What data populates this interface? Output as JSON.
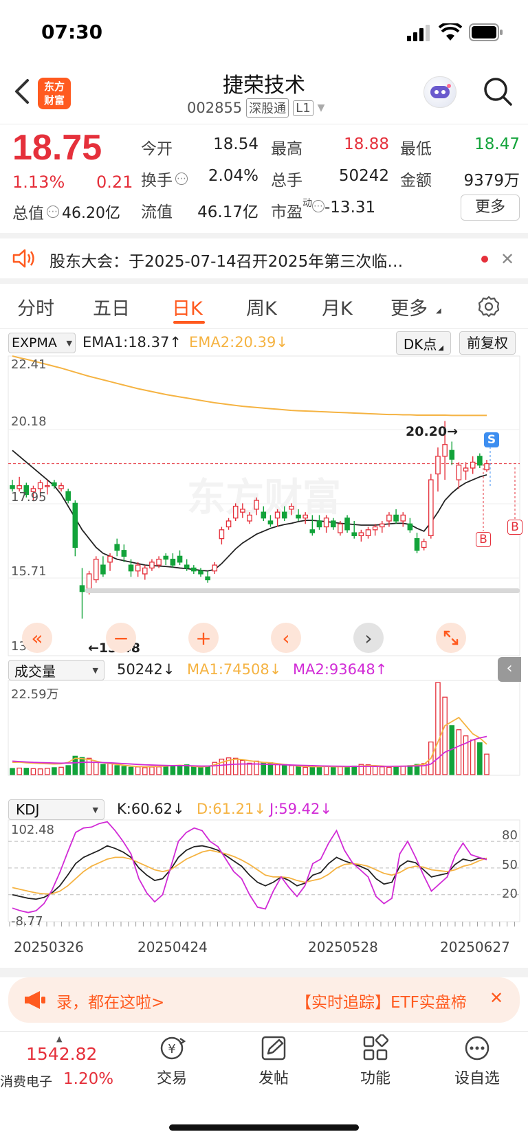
{
  "status_bar": {
    "time": "07:30"
  },
  "header": {
    "logo_line1": "东方",
    "logo_line2": "财富",
    "title": "捷荣技术",
    "code": "002855",
    "market_tag": "深股通",
    "level_tag": "L1"
  },
  "quote": {
    "price": "18.75",
    "change_pct": "1.13%",
    "change": "0.21",
    "fields": {
      "open_label": "今开",
      "open": "18.54",
      "high_label": "最高",
      "high": "18.88",
      "low_label": "最低",
      "low": "18.47",
      "turnover_label": "换手",
      "turnover": "2.04%",
      "volume_label": "总手",
      "volume": "50242",
      "amount_label": "金额",
      "amount": "9379万",
      "mktcap_label": "总值",
      "mktcap": "46.20亿",
      "float_label": "流值",
      "float": "46.17亿",
      "pe_label": "市盈",
      "pe_sup": "动",
      "pe": "-13.31"
    },
    "more_button": "更多"
  },
  "notice": {
    "text": "股东大会：于2025-07-14召开2025年第三次临…"
  },
  "tabs": {
    "items": [
      "分时",
      "五日",
      "日K",
      "周K",
      "月K",
      "更多"
    ],
    "active_index": 2
  },
  "kline": {
    "indicator_select": "EXPMA",
    "ema1": "EMA1:18.37",
    "ema2": "EMA2:20.39",
    "dk_button": "DK点",
    "adjust_button": "前复权",
    "y_labels": [
      "22.41",
      "20.18",
      "17.95",
      "15.71",
      "13.48"
    ],
    "high_marker": "20.20",
    "low_marker": "13.48",
    "signal_s": "S",
    "signal_b": "B",
    "watermark": "东方财富"
  },
  "volume_panel": {
    "indicator_select": "成交量",
    "value": "50242",
    "ma1": "MA1:74508",
    "ma2": "MA2:93648",
    "max_label": "22.59万"
  },
  "kdj_panel": {
    "indicator_select": "KDJ",
    "k": "K:60.62",
    "d": "D:61.21",
    "j": "J:59.42",
    "max_label": "102.48",
    "min_label": "-8.77",
    "levels": [
      "80",
      "50",
      "20"
    ]
  },
  "x_dates": [
    "20250326",
    "20250424",
    "20250528",
    "20250627"
  ],
  "ticker": {
    "left": "录，都在这啦>",
    "right": "【实时追踪】ETF实盘楴"
  },
  "bottom_nav": {
    "index_value": "1542.82",
    "index_name": "消费电子",
    "index_change": "1.20%",
    "items": [
      "交易",
      "发帖",
      "功能",
      "设自选"
    ]
  },
  "colors": {
    "up": "#e5303b",
    "down": "#12a33a",
    "ema2": "#f5b342",
    "ma2": "#d12bd6",
    "brand": "#ff5a1f"
  },
  "chart_data": [
    {
      "type": "candlestick",
      "title": "",
      "ylim": [
        13.48,
        22.41
      ],
      "x_labels": [
        "20250326",
        "20250424",
        "20250528",
        "20250627"
      ],
      "candles": [
        [
          18.0,
          18.2,
          17.8,
          17.9
        ],
        [
          17.9,
          18.3,
          17.8,
          18.0
        ],
        [
          18.0,
          18.1,
          17.6,
          17.7
        ],
        [
          17.8,
          18.0,
          17.5,
          17.9
        ],
        [
          17.9,
          18.2,
          17.6,
          18.1
        ],
        [
          18.0,
          18.2,
          17.7,
          18.0
        ],
        [
          18.1,
          18.2,
          17.9,
          18.0
        ],
        [
          17.9,
          18.1,
          17.8,
          18.0
        ],
        [
          17.8,
          17.9,
          17.4,
          17.5
        ],
        [
          17.4,
          17.5,
          15.6,
          15.9
        ],
        [
          14.6,
          15.2,
          13.48,
          14.4
        ],
        [
          14.5,
          15.1,
          14.3,
          15.0
        ],
        [
          14.8,
          15.6,
          14.7,
          15.5
        ],
        [
          15.3,
          15.6,
          14.9,
          15.0
        ],
        [
          15.4,
          15.7,
          15.1,
          15.6
        ],
        [
          16.0,
          16.2,
          15.6,
          15.8
        ],
        [
          15.8,
          16.0,
          15.4,
          15.6
        ],
        [
          15.3,
          15.5,
          14.9,
          15.1
        ],
        [
          15.1,
          15.4,
          14.9,
          15.3
        ],
        [
          15.0,
          15.3,
          14.8,
          15.2
        ],
        [
          15.2,
          15.5,
          15.1,
          15.4
        ],
        [
          15.3,
          15.6,
          15.2,
          15.5
        ],
        [
          15.6,
          15.7,
          15.3,
          15.5
        ],
        [
          15.5,
          15.7,
          15.2,
          15.3
        ],
        [
          15.6,
          15.8,
          15.3,
          15.4
        ],
        [
          15.3,
          15.5,
          15.1,
          15.2
        ],
        [
          15.2,
          15.3,
          15.0,
          15.1
        ],
        [
          15.1,
          15.2,
          14.9,
          15.0
        ],
        [
          14.9,
          15.1,
          14.7,
          14.8
        ],
        [
          15.1,
          15.4,
          15.0,
          15.3
        ],
        [
          16.2,
          16.6,
          16.0,
          16.5
        ],
        [
          16.6,
          16.9,
          16.5,
          16.8
        ],
        [
          16.9,
          17.4,
          16.8,
          17.3
        ],
        [
          17.1,
          17.4,
          16.9,
          17.2
        ],
        [
          16.8,
          17.1,
          16.7,
          17.0
        ],
        [
          17.2,
          17.6,
          17.0,
          17.5
        ],
        [
          17.1,
          17.3,
          16.8,
          16.9
        ],
        [
          16.8,
          17.0,
          16.6,
          16.7
        ],
        [
          16.9,
          17.2,
          16.6,
          17.1
        ],
        [
          17.1,
          17.3,
          16.8,
          16.9
        ],
        [
          17.2,
          17.4,
          17.0,
          17.3
        ],
        [
          17.0,
          17.2,
          16.8,
          16.9
        ],
        [
          16.9,
          17.1,
          16.7,
          17.0
        ],
        [
          16.5,
          17.0,
          16.3,
          16.4
        ],
        [
          16.8,
          17.0,
          16.5,
          16.6
        ],
        [
          16.6,
          17.0,
          16.4,
          16.9
        ],
        [
          16.8,
          16.9,
          16.5,
          16.6
        ],
        [
          16.4,
          16.8,
          16.3,
          16.7
        ],
        [
          16.9,
          17.0,
          16.4,
          16.5
        ],
        [
          16.4,
          16.8,
          16.2,
          16.3
        ],
        [
          16.3,
          16.5,
          16.1,
          16.4
        ],
        [
          16.3,
          16.6,
          16.2,
          16.5
        ],
        [
          16.5,
          16.7,
          16.3,
          16.6
        ],
        [
          16.6,
          16.8,
          16.4,
          16.7
        ],
        [
          16.8,
          17.1,
          16.6,
          17.0
        ],
        [
          17.0,
          17.2,
          16.7,
          16.8
        ],
        [
          16.8,
          17.1,
          16.6,
          17.0
        ],
        [
          16.7,
          16.9,
          16.4,
          16.5
        ],
        [
          16.2,
          16.4,
          15.7,
          15.8
        ],
        [
          15.9,
          16.2,
          15.8,
          16.1
        ],
        [
          16.3,
          18.4,
          16.2,
          18.2
        ],
        [
          18.4,
          19.3,
          17.8,
          19.0
        ],
        [
          19.0,
          20.2,
          18.2,
          19.4
        ],
        [
          19.2,
          19.5,
          18.7,
          18.9
        ],
        [
          18.2,
          18.8,
          17.9,
          18.7
        ],
        [
          18.5,
          18.8,
          18.2,
          18.6
        ],
        [
          18.6,
          19.0,
          18.4,
          18.8
        ],
        [
          19.0,
          19.1,
          18.6,
          18.7
        ],
        [
          18.54,
          18.88,
          18.47,
          18.75
        ]
      ],
      "ema1": [
        19.2,
        19.0,
        18.8,
        18.6,
        18.4,
        18.2,
        18.0,
        17.7,
        17.3,
        16.9,
        16.5,
        16.2,
        15.9,
        15.7,
        15.6,
        15.5,
        15.45,
        15.4,
        15.35,
        15.3,
        15.28,
        15.27,
        15.25,
        15.23,
        15.2,
        15.18,
        15.15,
        15.12,
        15.1,
        15.15,
        15.35,
        15.6,
        15.85,
        16.05,
        16.2,
        16.35,
        16.45,
        16.55,
        16.62,
        16.68,
        16.72,
        16.78,
        16.82,
        16.82,
        16.8,
        16.78,
        16.75,
        16.72,
        16.7,
        16.68,
        16.66,
        16.66,
        16.66,
        16.68,
        16.7,
        16.72,
        16.72,
        16.68,
        16.55,
        16.45,
        16.75,
        17.1,
        17.5,
        17.75,
        17.95,
        18.1,
        18.2,
        18.3,
        18.37
      ],
      "ema2": [
        22.41,
        22.35,
        22.3,
        22.24,
        22.18,
        22.12,
        22.06,
        22.0,
        21.93,
        21.86,
        21.79,
        21.72,
        21.66,
        21.6,
        21.54,
        21.48,
        21.42,
        21.36,
        21.3,
        21.25,
        21.2,
        21.15,
        21.1,
        21.06,
        21.02,
        20.98,
        20.94,
        20.9,
        20.86,
        20.82,
        20.79,
        20.76,
        20.73,
        20.7,
        20.68,
        20.66,
        20.64,
        20.62,
        20.6,
        20.58,
        20.56,
        20.55,
        20.54,
        20.53,
        20.52,
        20.51,
        20.5,
        20.49,
        20.48,
        20.47,
        20.46,
        20.45,
        20.44,
        20.43,
        20.42,
        20.42,
        20.41,
        20.41,
        20.4,
        20.4,
        20.4,
        20.4,
        20.4,
        20.39,
        20.39,
        20.39,
        20.39,
        20.39,
        20.39
      ]
    },
    {
      "type": "bar",
      "title": "",
      "ylim": [
        0,
        225900
      ],
      "values": [
        15000,
        16000,
        15500,
        14500,
        14000,
        15500,
        17000,
        18000,
        22000,
        45000,
        42000,
        40000,
        30000,
        25000,
        27000,
        22000,
        20000,
        18000,
        19000,
        17000,
        18500,
        19000,
        21000,
        20000,
        22000,
        24000,
        19000,
        18000,
        21000,
        30000,
        38000,
        41000,
        40000,
        35000,
        28000,
        33000,
        30000,
        29000,
        26000,
        25000,
        22000,
        20000,
        18000,
        19000,
        20000,
        21000,
        18000,
        20000,
        19000,
        21000,
        25000,
        24000,
        20000,
        19000,
        18000,
        20000,
        21000,
        22000,
        25000,
        27000,
        80000,
        225900,
        190000,
        120000,
        110000,
        95000,
        85000,
        78000,
        50242
      ],
      "ma1": [
        30000,
        30500,
        29000,
        28000,
        27000,
        26500,
        26000,
        26500,
        30000,
        40000,
        39000,
        37000,
        33000,
        29000,
        27000,
        25000,
        23000,
        21000,
        20000,
        19000,
        19500,
        20000,
        21000,
        22000,
        23000,
        22000,
        20000,
        19000,
        20000,
        24000,
        30000,
        35000,
        38000,
        37000,
        34000,
        32000,
        30000,
        29000,
        27000,
        25000,
        23000,
        21000,
        20000,
        19500,
        19500,
        20000,
        19500,
        19500,
        19500,
        20000,
        21000,
        22000,
        22000,
        21000,
        20000,
        20000,
        20500,
        21500,
        23000,
        25000,
        40000,
        80000,
        120000,
        130000,
        140000,
        120000,
        100000,
        90000,
        74508
      ],
      "ma2": [
        33000,
        32000,
        31000,
        30000,
        29500,
        29000,
        28500,
        28000,
        28500,
        29000,
        30000,
        30500,
        30000,
        29500,
        29000,
        28000,
        27000,
        26000,
        25000,
        24000,
        23500,
        23000,
        22500,
        22000,
        22000,
        21800,
        21500,
        21000,
        21000,
        21500,
        23000,
        24500,
        25500,
        26000,
        26000,
        26000,
        25500,
        25000,
        24500,
        24000,
        23500,
        23000,
        22500,
        22000,
        21500,
        21000,
        20800,
        20600,
        20400,
        20300,
        20200,
        20200,
        20300,
        20400,
        20500,
        20600,
        20700,
        20900,
        21200,
        21600,
        26000,
        40000,
        55000,
        62000,
        70000,
        77000,
        85000,
        90000,
        93648
      ]
    },
    {
      "type": "line",
      "title": "",
      "ylim": [
        -8.77,
        102.48
      ],
      "series": [
        {
          "name": "K",
          "values": [
            20,
            18,
            16,
            15,
            17,
            22,
            30,
            42,
            55,
            62,
            66,
            70,
            75,
            72,
            68,
            62,
            50,
            42,
            36,
            38,
            48,
            62,
            70,
            74,
            75,
            73,
            70,
            64,
            58,
            52,
            42,
            34,
            30,
            34,
            40,
            36,
            30,
            33,
            42,
            45,
            55,
            62,
            58,
            55,
            52,
            48,
            38,
            32,
            34,
            52,
            58,
            56,
            48,
            40,
            42,
            44,
            54,
            60,
            58,
            61,
            60.62
          ]
        },
        {
          "name": "D",
          "values": [
            28,
            26,
            24,
            22,
            21,
            21,
            24,
            30,
            38,
            46,
            52,
            56,
            60,
            62,
            62,
            60,
            56,
            52,
            48,
            46,
            48,
            54,
            60,
            64,
            68,
            70,
            68,
            66,
            63,
            59,
            54,
            48,
            42,
            40,
            40,
            39,
            36,
            34,
            36,
            38,
            43,
            50,
            54,
            55,
            54,
            52,
            48,
            44,
            42,
            45,
            50,
            52,
            51,
            48,
            47,
            46,
            48,
            52,
            54,
            58,
            61.21
          ]
        },
        {
          "name": "J",
          "values": [
            5,
            2,
            0,
            2,
            10,
            25,
            45,
            68,
            90,
            95,
            96,
            100,
            102,
            92,
            80,
            66,
            38,
            22,
            12,
            20,
            50,
            80,
            90,
            95,
            92,
            80,
            74,
            60,
            46,
            38,
            20,
            6,
            4,
            24,
            40,
            28,
            18,
            30,
            55,
            60,
            78,
            92,
            70,
            56,
            48,
            40,
            18,
            10,
            16,
            66,
            80,
            62,
            42,
            24,
            32,
            40,
            64,
            78,
            65,
            62,
            59.42
          ]
        }
      ],
      "levels": [
        80,
        50,
        20
      ]
    }
  ]
}
